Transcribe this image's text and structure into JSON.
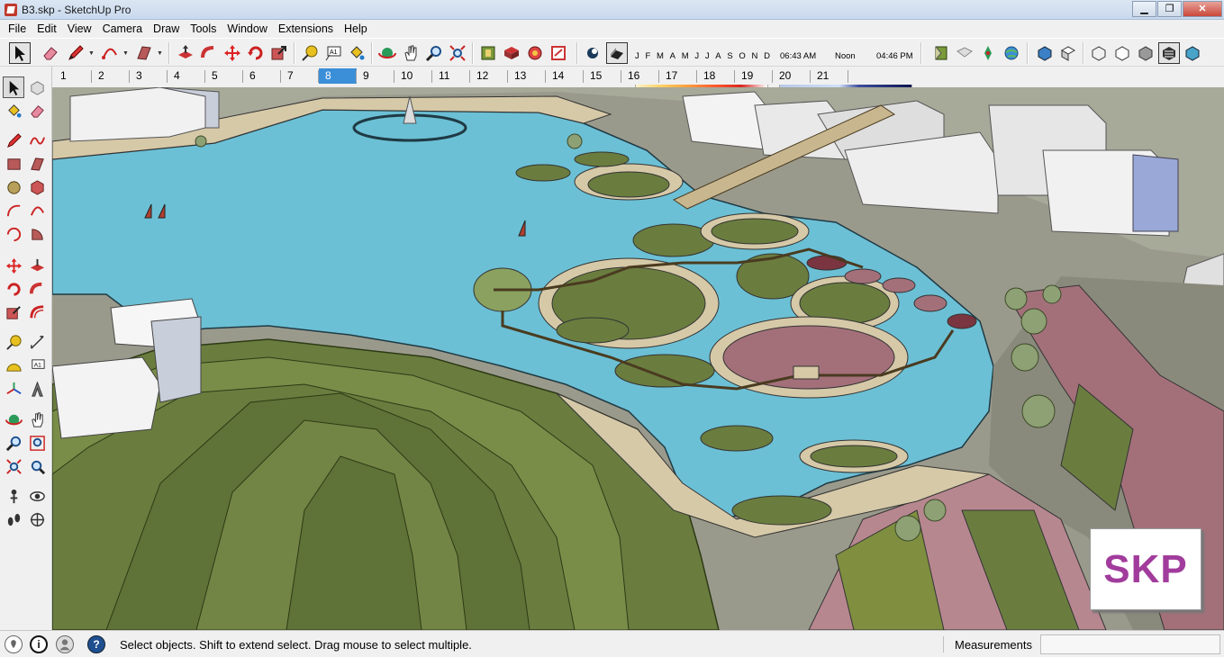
{
  "window": {
    "title": "B3.skp - SketchUp Pro",
    "minimize_glyph": "▁",
    "maximize_glyph": "❐",
    "close_glyph": "✕"
  },
  "menu": [
    "File",
    "Edit",
    "View",
    "Camera",
    "Draw",
    "Tools",
    "Window",
    "Extensions",
    "Help"
  ],
  "shadows": {
    "months": [
      "J",
      "F",
      "M",
      "A",
      "M",
      "J",
      "J",
      "A",
      "S",
      "O",
      "N",
      "D"
    ],
    "time_start": "06:43 AM",
    "time_mid": "Noon",
    "time_end": "04:46 PM"
  },
  "scenes_ruler": {
    "tabs": [
      "1",
      "2",
      "3",
      "4",
      "5",
      "6",
      "7",
      "8",
      "9",
      "10",
      "11",
      "12",
      "13",
      "14",
      "15",
      "16",
      "17",
      "18",
      "19",
      "20",
      "21"
    ],
    "active": "8"
  },
  "viewport": {
    "watermark": "SKP"
  },
  "statusbar": {
    "hint": "Select objects. Shift to extend select. Drag mouse to select multiple.",
    "measurements_label": "Measurements",
    "measurements_value": "",
    "info_glyph": "i",
    "help_glyph": "?"
  },
  "colors": {
    "water": "#6cc0d5",
    "grass": "#6a7d3f",
    "path": "#d6c9a8",
    "brick": "#a3707a",
    "accent_active": "#3b8ed8",
    "watermark": "#a13c9c"
  }
}
